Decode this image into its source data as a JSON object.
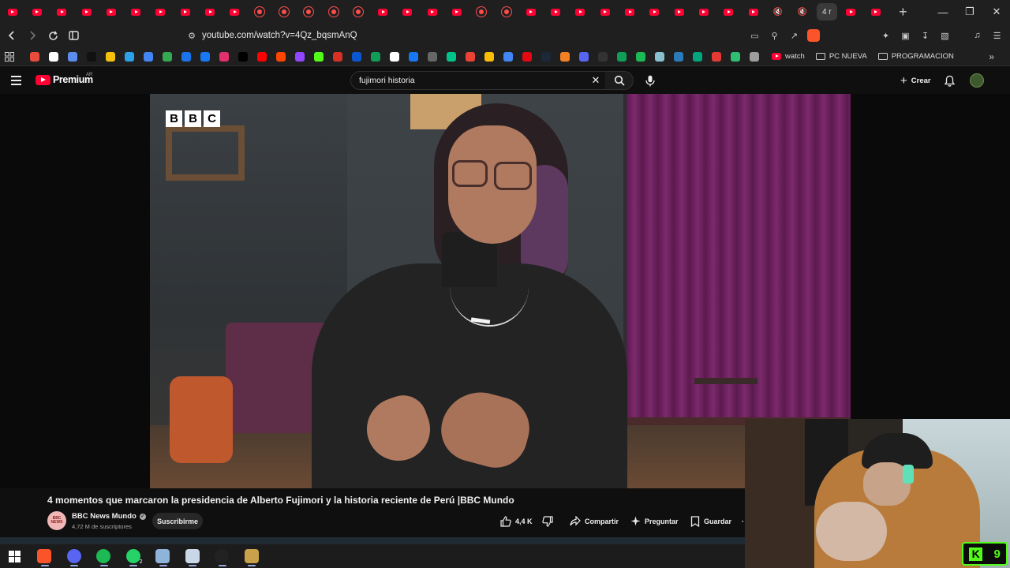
{
  "browser": {
    "tabs": [
      "yt",
      "yt",
      "yt",
      "yt",
      "yt",
      "yt",
      "yt",
      "yt",
      "yt",
      "yt",
      "ring",
      "ring",
      "ring",
      "ring",
      "ring",
      "yt",
      "yt",
      "yt",
      "yt",
      "ring",
      "ring",
      "yt",
      "yt",
      "yt",
      "yt",
      "yt",
      "yt",
      "yt",
      "yt",
      "yt",
      "yt",
      "muted",
      "muted"
    ],
    "active_tab_label": "4 r",
    "new_tab": "+",
    "url": "youtube.com/watch?v=4Qz_bqsmAnQ",
    "bookmarks": [
      {
        "color": "#e74c3c"
      },
      {
        "color": "#ffffff"
      },
      {
        "color": "#5b8def"
      },
      {
        "color": "#111111"
      },
      {
        "color": "#f4c20d"
      },
      {
        "color": "#2aa1e8"
      },
      {
        "color": "#4285f4"
      },
      {
        "color": "#34a853"
      },
      {
        "color": "#1a73e8"
      },
      {
        "color": "#1877f2"
      },
      {
        "color": "#e1306c"
      },
      {
        "color": "#000000"
      },
      {
        "color": "#ff0000"
      },
      {
        "color": "#ff4500"
      },
      {
        "color": "#9146ff"
      },
      {
        "color": "#53fc18"
      },
      {
        "color": "#d93025"
      },
      {
        "color": "#0b57d0"
      },
      {
        "color": "#0f9d58"
      },
      {
        "color": "#ffffff"
      },
      {
        "color": "#1877f2"
      },
      {
        "color": "#666666"
      },
      {
        "color": "#00c389"
      },
      {
        "color": "#ea4335"
      },
      {
        "color": "#fbbc04"
      },
      {
        "color": "#4285f4"
      },
      {
        "color": "#e50914"
      },
      {
        "color": "#1b2838"
      },
      {
        "color": "#f48024"
      },
      {
        "color": "#5865f2"
      },
      {
        "color": "#333333"
      },
      {
        "color": "#0f9d58"
      },
      {
        "color": "#1db954"
      },
      {
        "color": "#88c0d0"
      },
      {
        "color": "#2b7bb9"
      },
      {
        "color": "#00a67e"
      },
      {
        "color": "#e53935"
      },
      {
        "color": "#2fbf71"
      },
      {
        "color": "#9e9e9e"
      }
    ],
    "bookmark_labels": {
      "watch": "watch",
      "folder1": "PC NUEVA",
      "folder2": "PROGRAMACION"
    },
    "more_bookmarks": "»"
  },
  "youtube": {
    "logo_text": "Premium",
    "country": "AR",
    "search_value": "fujimori historia",
    "create_label": "Crear",
    "video": {
      "watermark": [
        "B",
        "B",
        "C"
      ],
      "title": "4 momentos que marcaron la presidencia de Alberto Fujimori y la historia reciente de Perú |BBC Mundo",
      "channel_name": "BBC News Mundo",
      "channel_avatar_text": "BBC NEWS",
      "subscribers": "4,72 M de suscriptores",
      "subscribe_label": "Suscribirme",
      "likes": "4,4 K",
      "share_label": "Compartir",
      "ask_label": "Preguntar",
      "save_label": "Guardar"
    }
  },
  "overlay": {
    "kick_letter": "K",
    "viewer_count": "9"
  },
  "taskbar": {
    "items": [
      {
        "name": "windows-start",
        "color": "#1e90ff",
        "glyph": ""
      },
      {
        "name": "brave",
        "color": "#fb542b",
        "glyph": ""
      },
      {
        "name": "discord",
        "color": "#5865f2",
        "glyph": ""
      },
      {
        "name": "spotify",
        "color": "#1db954",
        "glyph": ""
      },
      {
        "name": "whatsapp",
        "color": "#25d366",
        "glyph": "",
        "badge": "2"
      },
      {
        "name": "notepad",
        "color": "#8fb4d9",
        "glyph": ""
      },
      {
        "name": "paint",
        "color": "#c9d8e6",
        "glyph": ""
      },
      {
        "name": "obs",
        "color": "#222222",
        "glyph": ""
      },
      {
        "name": "league",
        "color": "#c9a14a",
        "glyph": ""
      }
    ]
  }
}
